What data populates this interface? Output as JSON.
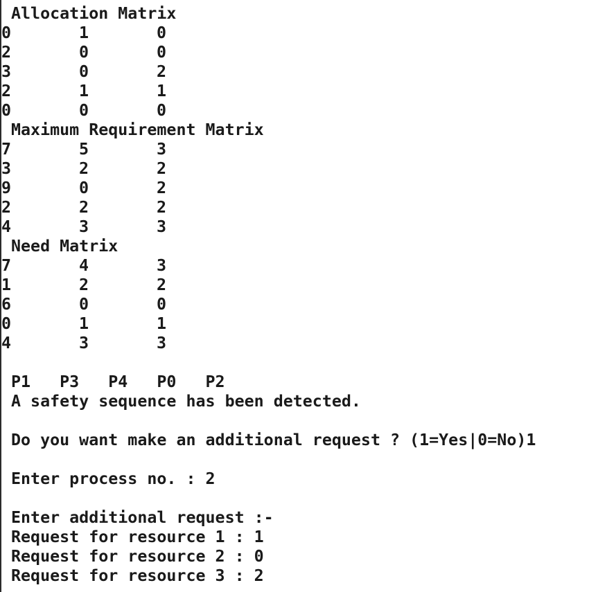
{
  "terminal": {
    "allocation": {
      "title": "Allocation Matrix",
      "rows": [
        [
          "0",
          "1",
          "0"
        ],
        [
          "2",
          "0",
          "0"
        ],
        [
          "3",
          "0",
          "2"
        ],
        [
          "2",
          "1",
          "1"
        ],
        [
          "0",
          "0",
          "0"
        ]
      ]
    },
    "maximum": {
      "title": "Maximum Requirement Matrix",
      "rows": [
        [
          "7",
          "5",
          "3"
        ],
        [
          "3",
          "2",
          "2"
        ],
        [
          "9",
          "0",
          "2"
        ],
        [
          "2",
          "2",
          "2"
        ],
        [
          "4",
          "3",
          "3"
        ]
      ]
    },
    "need": {
      "title": "Need Matrix",
      "rows": [
        [
          "7",
          "4",
          "3"
        ],
        [
          "1",
          "2",
          "2"
        ],
        [
          "6",
          "0",
          "0"
        ],
        [
          "0",
          "1",
          "1"
        ],
        [
          "4",
          "3",
          "3"
        ]
      ]
    },
    "sequence": "P1   P3   P4   P0   P2",
    "safety_message": "A safety sequence has been detected.",
    "additional_prompt": "Do you want make an additional request ? (1=Yes|0=No)1",
    "process_prompt": "Enter process no. : 2",
    "request_header": "Enter additional request :-",
    "resource_requests": [
      "Request for resource 1 : 1",
      "Request for resource 2 : 0",
      "Request for resource 3 : 2"
    ]
  }
}
